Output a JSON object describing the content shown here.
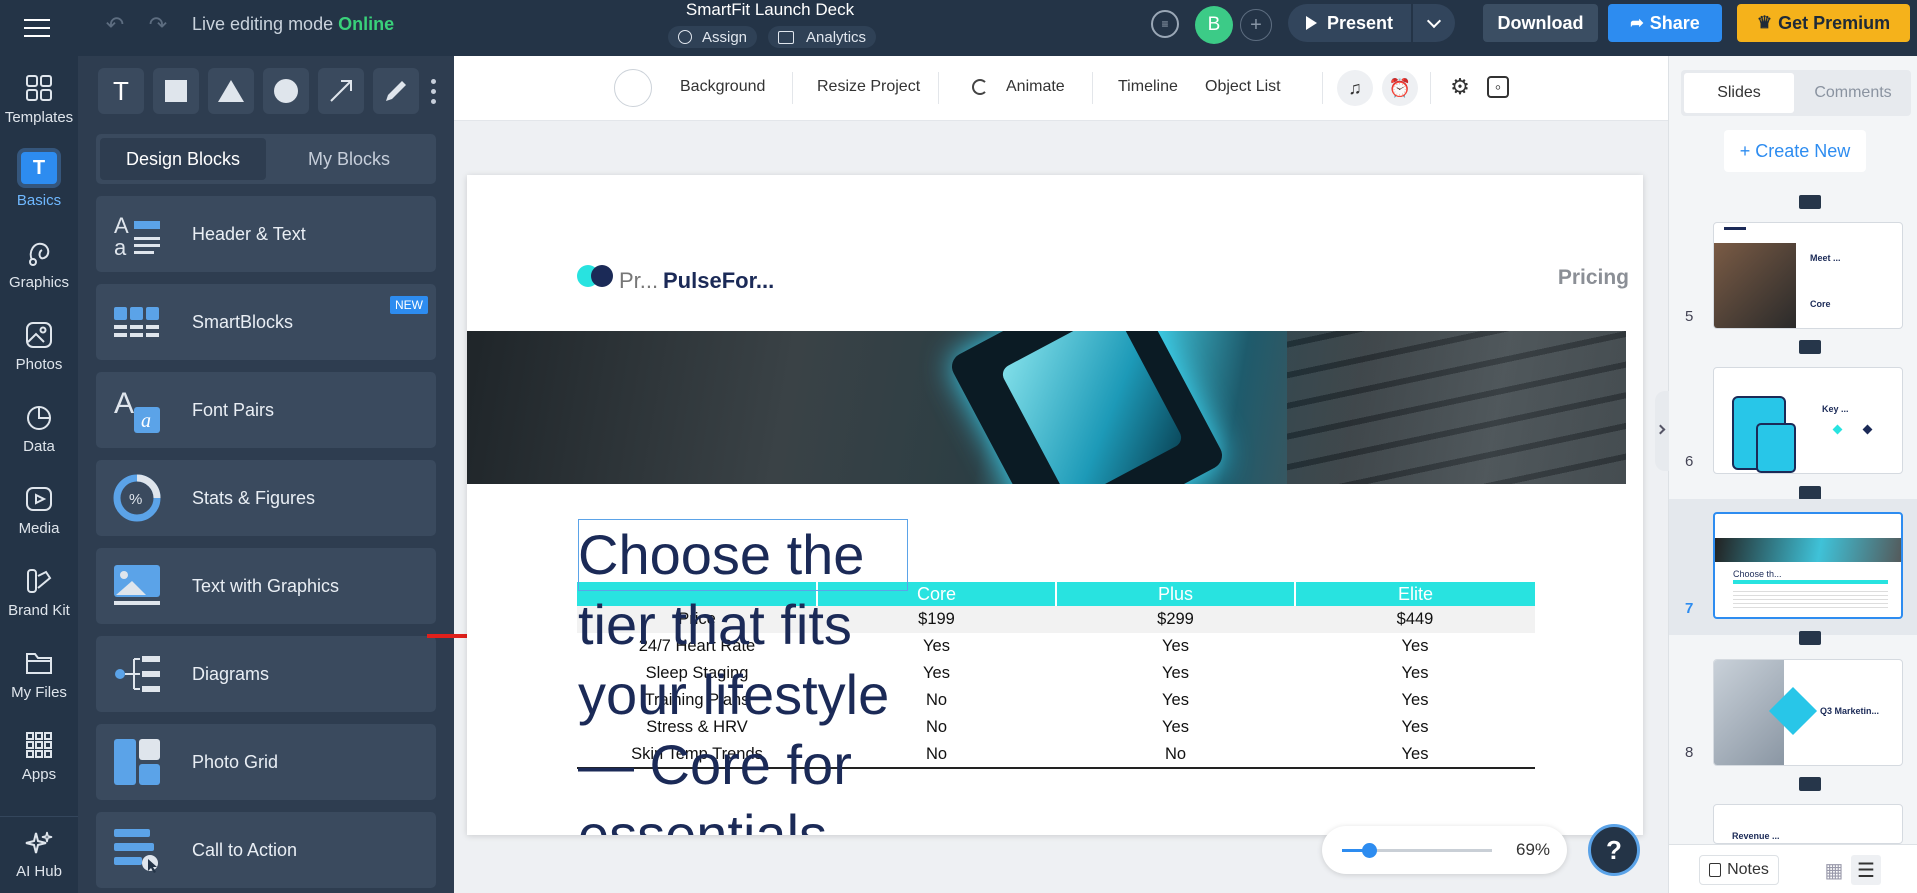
{
  "topbar": {
    "live_label": "Live editing mode",
    "live_status": "Online",
    "doc_title": "SmartFit Launch Deck",
    "assign": "Assign",
    "analytics": "Analytics",
    "avatar": "B",
    "present": "Present",
    "download": "Download",
    "share": "Share",
    "premium": "Get Premium"
  },
  "leftnav": {
    "items": [
      {
        "label": "Templates",
        "icon": "templates-icon"
      },
      {
        "label": "Basics",
        "icon": "basics-icon"
      },
      {
        "label": "Graphics",
        "icon": "graphics-icon"
      },
      {
        "label": "Photos",
        "icon": "photos-icon"
      },
      {
        "label": "Data",
        "icon": "data-icon"
      },
      {
        "label": "Media",
        "icon": "media-icon"
      },
      {
        "label": "Brand Kit",
        "icon": "brand-kit-icon"
      },
      {
        "label": "My Files",
        "icon": "folder-icon"
      },
      {
        "label": "Apps",
        "icon": "apps-icon"
      },
      {
        "label": "AI Hub",
        "icon": "ai-hub-icon"
      }
    ]
  },
  "panel": {
    "tab_design": "Design Blocks",
    "tab_my": "My Blocks",
    "new_badge": "NEW",
    "blocks": [
      {
        "label": "Header & Text"
      },
      {
        "label": "SmartBlocks"
      },
      {
        "label": "Font Pairs"
      },
      {
        "label": "Stats & Figures"
      },
      {
        "label": "Text with Graphics"
      },
      {
        "label": "Diagrams"
      },
      {
        "label": "Photo Grid"
      },
      {
        "label": "Call to Action"
      }
    ]
  },
  "canvas_toolbar": {
    "background": "Background",
    "resize": "Resize Project",
    "animate": "Animate",
    "timeline": "Timeline",
    "object_list": "Object List"
  },
  "slide": {
    "logo_short": "Pr...",
    "logo_name": "PulseFor...",
    "section": "Pricing",
    "heading": "Choose the tier that fits your lifestyle — Core for essentials",
    "table": {
      "headers": [
        "",
        "Core",
        "Plus",
        "Elite"
      ],
      "rows": [
        [
          "Price",
          "$199",
          "$299",
          "$449"
        ],
        [
          "24/7 Heart Rate",
          "Yes",
          "Yes",
          "Yes"
        ],
        [
          "Sleep Staging",
          "Yes",
          "Yes",
          "Yes"
        ],
        [
          "Training Plans",
          "No",
          "Yes",
          "Yes"
        ],
        [
          "Stress & HRV",
          "No",
          "Yes",
          "Yes"
        ],
        [
          "Skin Temp Trends",
          "No",
          "No",
          "Yes"
        ]
      ]
    }
  },
  "zoom": {
    "value": "69%",
    "level": 0.18
  },
  "help": "?",
  "rightpanel": {
    "tab_slides": "Slides",
    "tab_comments": "Comments",
    "create_new": "+ Create New",
    "thumbs": [
      {
        "num": "5",
        "title": "Meet ...",
        "sub": "Core"
      },
      {
        "num": "6",
        "title": "Key ..."
      },
      {
        "num": "7",
        "title": "Choose th..."
      },
      {
        "num": "8",
        "title": "Q3 Marketin..."
      },
      {
        "num": "",
        "title": "Revenue ..."
      }
    ],
    "notes": "Notes"
  },
  "colors": {
    "bg_dark": "#243447",
    "panel": "#2e3d50",
    "accent_blue": "#2d8cf0",
    "premium": "#f5b21b",
    "online": "#39d17a",
    "teal": "#28e3e0",
    "heading": "#1b2a57"
  }
}
